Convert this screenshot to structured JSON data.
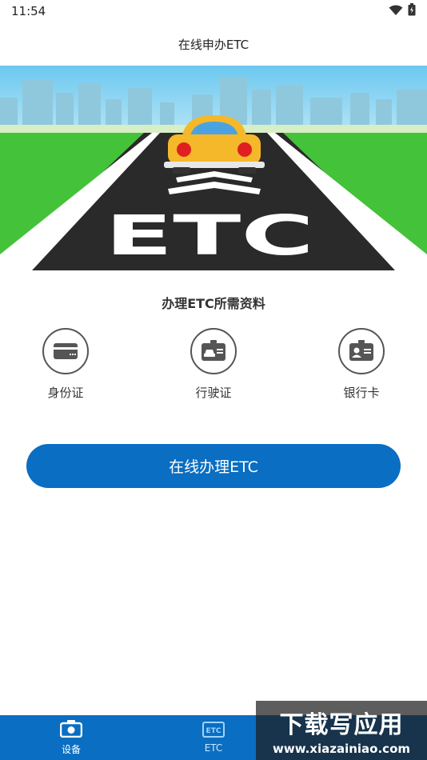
{
  "status": {
    "time": "11:54",
    "wifi_icon": "wifi-icon",
    "battery_icon": "battery-icon"
  },
  "header": {
    "title": "在线申办ETC"
  },
  "banner": {
    "road_text": "ETC"
  },
  "section": {
    "title": "办理ETC所需资料"
  },
  "docs": [
    {
      "label": "身份证",
      "icon": "id-card-icon"
    },
    {
      "label": "行驶证",
      "icon": "vehicle-license-icon"
    },
    {
      "label": "银行卡",
      "icon": "bank-card-icon"
    }
  ],
  "cta": {
    "label": "在线办理ETC"
  },
  "nav": [
    {
      "label": "设备",
      "icon": "device-icon",
      "active": false
    },
    {
      "label": "ETC",
      "icon": "etc-icon",
      "active": true
    },
    {
      "label": "",
      "icon": "",
      "active": false
    }
  ],
  "watermark": {
    "title": "下载写应用",
    "url": "www.xiazainiao.com"
  },
  "colors": {
    "primary": "#0a6ec2",
    "sky": "#7fd0f2",
    "grass": "#44c23a",
    "road": "#2a2a2a",
    "car": "#f5b82a"
  }
}
